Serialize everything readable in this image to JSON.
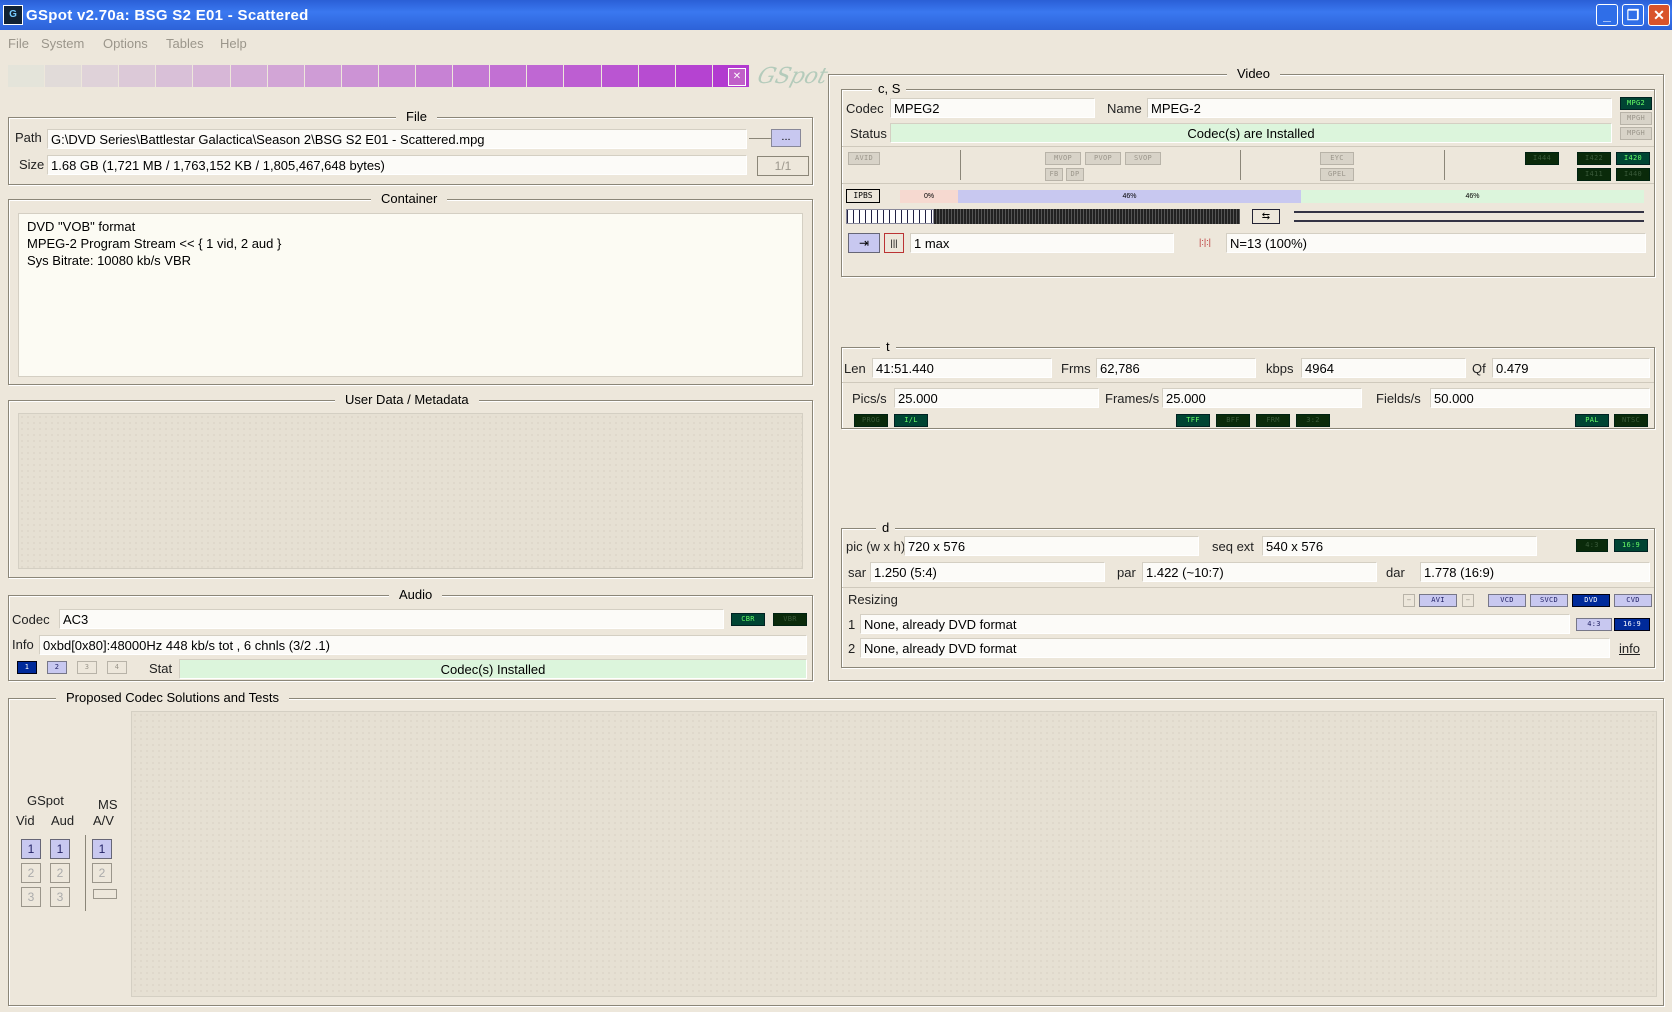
{
  "window": {
    "title": "GSpot v2.70a: BSG S2 E01 - Scattered",
    "controls": {
      "minimize": "_",
      "restore": "❐",
      "close": "✕"
    }
  },
  "menu": [
    "File",
    "System",
    "Options",
    "Tables",
    "Help"
  ],
  "logo": "GSpot",
  "file": {
    "title": "File",
    "path_label": "Path",
    "path": "G:\\DVD Series\\Battlestar Galactica\\Season 2\\BSG S2 E01 - Scattered.mpg",
    "browse": "...",
    "size_label": "Size",
    "size": "1.68 GB (1,721 MB / 1,763,152 KB / 1,805,467,648 bytes)",
    "page": "1/1"
  },
  "container": {
    "title": "Container",
    "lines": [
      "DVD \"VOB\" format",
      "MPEG-2 Program Stream << { 1 vid, 2 aud }",
      "Sys Bitrate: 10080 kb/s VBR"
    ]
  },
  "userdata": {
    "title": "User Data / Metadata"
  },
  "audio": {
    "title": "Audio",
    "codec_label": "Codec",
    "codec": "AC3",
    "tag_cbr": "CBR",
    "tag_vbr": "VBR",
    "info_label": "Info",
    "info": "0xbd[0x80]:48000Hz  448 kb/s tot , 6 chnls (3/2 .1)",
    "streams": [
      "1",
      "2",
      "3",
      "4"
    ],
    "stat_label": "Stat",
    "stat": "Codec(s) Installed"
  },
  "video": {
    "title": "Video",
    "cs": {
      "title": "c, S",
      "codec_label": "Codec",
      "codec": "MPEG2",
      "name_label": "Name",
      "name": "MPEG-2",
      "status_label": "Status",
      "status": "Codec(s) are Installed",
      "side_tags": [
        "MPG2",
        "MPGH",
        "MPGH"
      ]
    },
    "flags": {
      "left": "AVID",
      "mid": [
        "MVOP",
        "PVOP",
        "SVOP"
      ],
      "mid2": [
        "FB",
        "DP"
      ],
      "r1": "EYC",
      "r2": "GPEL",
      "right1": [
        "I444",
        "I422",
        "I420"
      ],
      "right2": [
        "I411",
        "I440"
      ]
    },
    "gop": {
      "label": "IPBS",
      "pcts": [
        "0%",
        "46%",
        "46%"
      ],
      "max": "1 max",
      "n": "N=13 (100%)"
    },
    "t": {
      "title": "t",
      "len_label": "Len",
      "len": "41:51.440",
      "frms_label": "Frms",
      "frms": "62,786",
      "kbps_label": "kbps",
      "kbps": "4964",
      "qf_label": "Qf",
      "qf": "0.479",
      "pics_label": "Pics/s",
      "pics": "25.000",
      "frames_label": "Frames/s",
      "frames": "25.000",
      "fields_label": "Fields/s",
      "fields": "50.000",
      "tags_left": [
        "PROG",
        "I/L"
      ],
      "tags_mid": [
        "TFF",
        "BFF",
        "FRM",
        "3:2"
      ],
      "tags_right": [
        "PAL",
        "NTSC"
      ]
    },
    "d": {
      "title": "d",
      "pic_label": "pic (w x h)",
      "pic": "720 x 576",
      "seq_label": "seq ext",
      "seq": "540 x 576",
      "sar_label": "sar",
      "sar": "1.250 (5:4)",
      "par_label": "par",
      "par": "1.422 (~10:7)",
      "dar_label": "dar",
      "dar": "1.778 (16:9)",
      "seq_tags": [
        "4:3",
        "16:9"
      ],
      "resizing_label": "Resizing",
      "resize_tags": [
        "AVI",
        "VCD",
        "SVCD",
        "DVD",
        "CVD"
      ],
      "aspect_tags": [
        "4:3",
        "16:9"
      ],
      "row1_num": "1",
      "row1": "None, already DVD format",
      "row2_num": "2",
      "row2": "None, already DVD format",
      "info_link": "info"
    }
  },
  "codec_solutions": {
    "title": "Proposed Codec Solutions and Tests",
    "gspot": "GSpot",
    "vid": "Vid",
    "aud": "Aud",
    "ms": "MS",
    "av": "A/V",
    "btn": [
      "1",
      "2",
      "3"
    ]
  },
  "colors": {
    "title_bar": "#2a5fd6",
    "panel_bg": "#ede7db",
    "green_status": "#dcf5dc",
    "tag_on": "#004433"
  }
}
